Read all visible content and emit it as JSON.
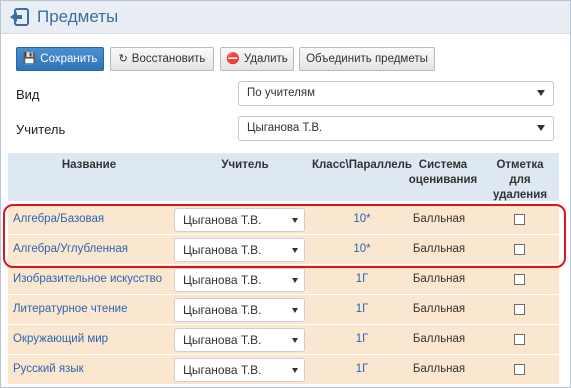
{
  "header": {
    "title": "Предметы",
    "back_icon": "back-arrow-icon"
  },
  "toolbar": {
    "save_label": "Сохранить",
    "restore_label": "Восстановить",
    "delete_label": "Удалить",
    "merge_label": "Объединить предметы",
    "save_color": "#337ab7"
  },
  "form": {
    "view_label": "Вид",
    "view_value": "По учителям",
    "teacher_label": "Учитель",
    "teacher_value": "Цыганова Т.В."
  },
  "table": {
    "headers": {
      "name": "Название",
      "teacher": "Учитель",
      "class": "Класс\\Параллель",
      "system_line1": "Система",
      "system_line2": "оценивания",
      "mark_line1": "Отметка",
      "mark_line2": "для",
      "mark_line3": "удаления"
    },
    "rows": [
      {
        "name": "Алгебра/Базовая",
        "teacher": "Цыганова Т.В.",
        "class": "10*",
        "system": "Балльная"
      },
      {
        "name": "Алгебра/Углубленная",
        "teacher": "Цыганова Т.В.",
        "class": "10*",
        "system": "Балльная"
      },
      {
        "name": "Изобразительное искусство",
        "teacher": "Цыганова Т.В.",
        "class": "1Г",
        "system": "Балльная"
      },
      {
        "name": "Литературное чтение",
        "teacher": "Цыганова Т.В.",
        "class": "1Г",
        "system": "Балльная"
      },
      {
        "name": "Окружающий мир",
        "teacher": "Цыганова Т.В.",
        "class": "1Г",
        "system": "Балльная"
      },
      {
        "name": "Русский язык",
        "teacher": "Цыганова Т.В.",
        "class": "1Г",
        "system": "Балльная"
      }
    ],
    "row_color": "#fbe7cf",
    "header_color": "#dde8f3",
    "highlight_color": "#e0141b"
  }
}
